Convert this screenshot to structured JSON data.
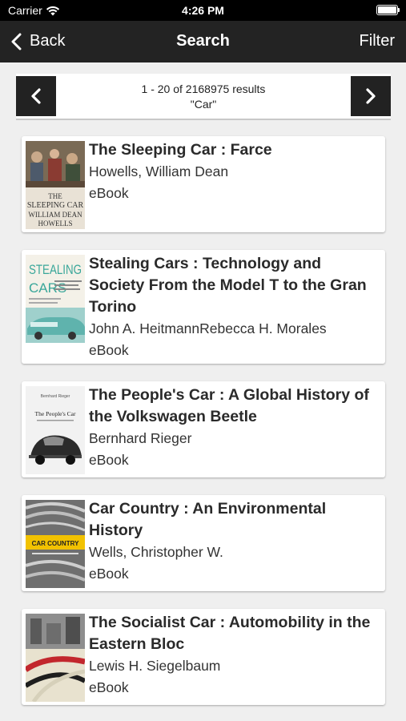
{
  "status_bar": {
    "carrier": "Carrier",
    "time": "4:26 PM"
  },
  "nav": {
    "back_label": "Back",
    "title": "Search",
    "filter_label": "Filter"
  },
  "pager": {
    "range_text": "1 - 20 of 2168975 results",
    "query_text": "\"Car\""
  },
  "results": [
    {
      "title": "The Sleeping Car : Farce",
      "author": "Howells, William Dean",
      "format": "eBook",
      "cover_text": {
        "line1": "THE",
        "line2": "SLEEPING CAR",
        "line3": "WILLIAM DEAN",
        "line4": "HOWELLS"
      }
    },
    {
      "title": "Stealing Cars : Technology and Society From the Model T to the Gran Torino",
      "author": "John A. HeitmannRebecca H. Morales",
      "format": "eBook",
      "cover_text": {
        "line1": "STEALING",
        "line2": "CARS"
      }
    },
    {
      "title": "The People's Car : A Global History of the Volkswagen Beetle",
      "author": "Bernhard Rieger",
      "format": "eBook",
      "cover_text": {
        "line1": "Bernhard Rieger",
        "line2": "The People's Car"
      }
    },
    {
      "title": "Car Country : An Environmental History",
      "author": "Wells, Christopher W.",
      "format": "eBook",
      "cover_text": {
        "line1": "CAR COUNTRY"
      }
    },
    {
      "title": "The Socialist Car : Automobility in the Eastern Bloc",
      "author": "Lewis H. Siegelbaum",
      "format": "eBook"
    }
  ],
  "colors": {
    "nav_bg": "#232323",
    "pager_button": "#222222",
    "page_bg": "#efefef",
    "card_bg": "#ffffff"
  }
}
